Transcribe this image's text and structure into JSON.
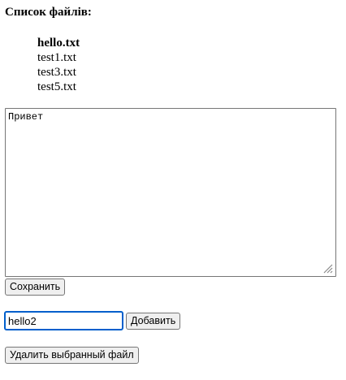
{
  "heading": "Список файлів:",
  "files": [
    {
      "name": "hello.txt",
      "selected": true
    },
    {
      "name": "test1.txt",
      "selected": false
    },
    {
      "name": "test3.txt",
      "selected": false
    },
    {
      "name": "test5.txt",
      "selected": false
    }
  ],
  "editor": {
    "content": "Привет"
  },
  "buttons": {
    "save": "Сохранить",
    "add": "Добавить",
    "delete": "Удалить выбранный файл"
  },
  "new_file": {
    "value": "hello2"
  },
  "colors": {
    "focus_border": "#005fcc",
    "button_bg": "#efefef",
    "border": "#767676"
  }
}
